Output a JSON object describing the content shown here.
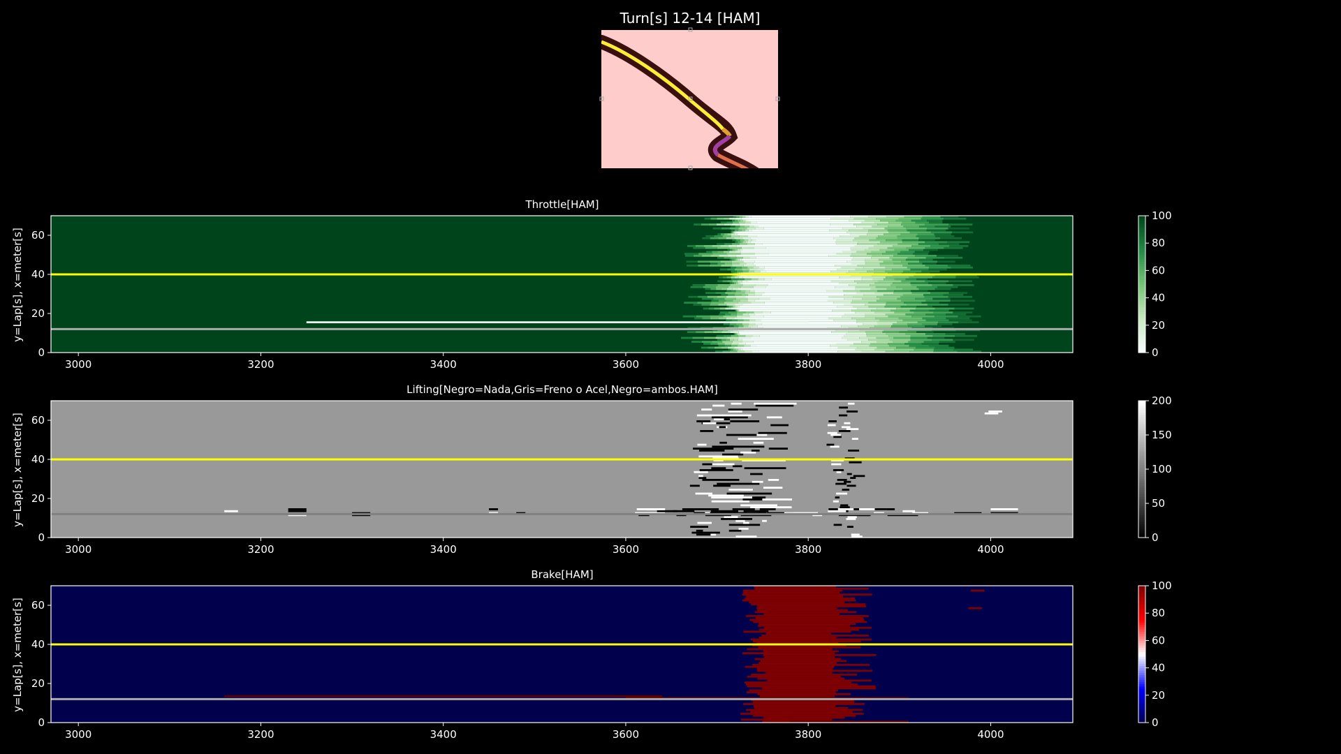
{
  "figure": {
    "title": "Turn[s] 12-14 [HAM]",
    "background": "#000000",
    "map": {
      "background": "#ffcccc",
      "track_color": "#3a0f0f",
      "line_colors": [
        "#ffee33",
        "#e0a030",
        "#a040a0",
        "#e0704a"
      ]
    }
  },
  "chart_data": [
    {
      "type": "heatmap",
      "title": "Throttle[HAM]",
      "xlabel": "",
      "ylabel": "y=Lap[s], x=meter[s]",
      "xlim": [
        2970,
        4090
      ],
      "ylim": [
        0,
        70
      ],
      "xticks": [
        3000,
        3200,
        3400,
        3600,
        3800,
        4000
      ],
      "yticks": [
        0,
        20,
        40,
        60
      ],
      "colormap": "Greens",
      "cmap_colors": [
        "#f7fcfd",
        "#c7e9c0",
        "#74c476",
        "#238b45",
        "#00441b"
      ],
      "base_color": "#00441b",
      "clim": [
        0,
        100
      ],
      "colorbar_ticks": [
        0,
        20,
        40,
        60,
        80,
        100
      ],
      "hlines": [
        {
          "y": 40,
          "color": "#ffff00"
        },
        {
          "y": 12,
          "color": "#aaaaaa"
        }
      ],
      "profile": {
        "low_start": 3740,
        "low_end": 3840,
        "low_value": 2,
        "entry_start": 3660,
        "exit_end": 3960,
        "lap15_low": [
          3250,
          3800
        ]
      }
    },
    {
      "type": "heatmap",
      "title": "Lifting[Negro=Nada,Gris=Freno o Acel,Negro=ambos.HAM]",
      "xlabel": "",
      "ylabel": "y=Lap[s], x=meter[s]",
      "xlim": [
        2970,
        4090
      ],
      "ylim": [
        0,
        70
      ],
      "xticks": [
        3000,
        3200,
        3400,
        3600,
        3800,
        4000
      ],
      "yticks": [
        0,
        20,
        40,
        60
      ],
      "colormap": "gray",
      "cmap_colors": [
        "#000000",
        "#ffffff"
      ],
      "base_color": "#999999",
      "clim": [
        0,
        200
      ],
      "colorbar_ticks": [
        0,
        50,
        100,
        150,
        200
      ],
      "hlines": [
        {
          "y": 40,
          "color": "#ffff00"
        },
        {
          "y": 12,
          "color": "#808080"
        }
      ],
      "profile": {
        "zone1": [
          3670,
          3790
        ],
        "zone2": [
          3820,
          3860
        ],
        "sparse": [
          [
            3160,
            3175
          ],
          [
            3230,
            3250
          ],
          [
            3300,
            3320
          ],
          [
            3450,
            3460
          ],
          [
            3480,
            3490
          ],
          [
            3960,
            3990
          ],
          [
            4000,
            4030
          ]
        ]
      }
    },
    {
      "type": "heatmap",
      "title": "Brake[HAM]",
      "xlabel": "",
      "ylabel": "y=Lap[s], x=meter[s]",
      "xlim": [
        2970,
        4090
      ],
      "ylim": [
        0,
        70
      ],
      "xticks": [
        3000,
        3200,
        3400,
        3600,
        3800,
        4000
      ],
      "yticks": [
        0,
        20,
        40,
        60
      ],
      "colormap": "seismic",
      "cmap_colors": [
        "#00004c",
        "#0000ff",
        "#ffffff",
        "#ff0000",
        "#7f0000"
      ],
      "base_color": "#00004c",
      "clim": [
        0,
        100
      ],
      "colorbar_ticks": [
        0,
        20,
        40,
        60,
        80,
        100
      ],
      "hlines": [
        {
          "y": 40,
          "color": "#ffff00"
        },
        {
          "y": 12,
          "color": "#aaaaaa"
        }
      ],
      "profile": {
        "brake_start": 3740,
        "brake_end": 3850,
        "brake_value": 100,
        "lap13_band": [
          3160,
          3640
        ]
      }
    }
  ]
}
